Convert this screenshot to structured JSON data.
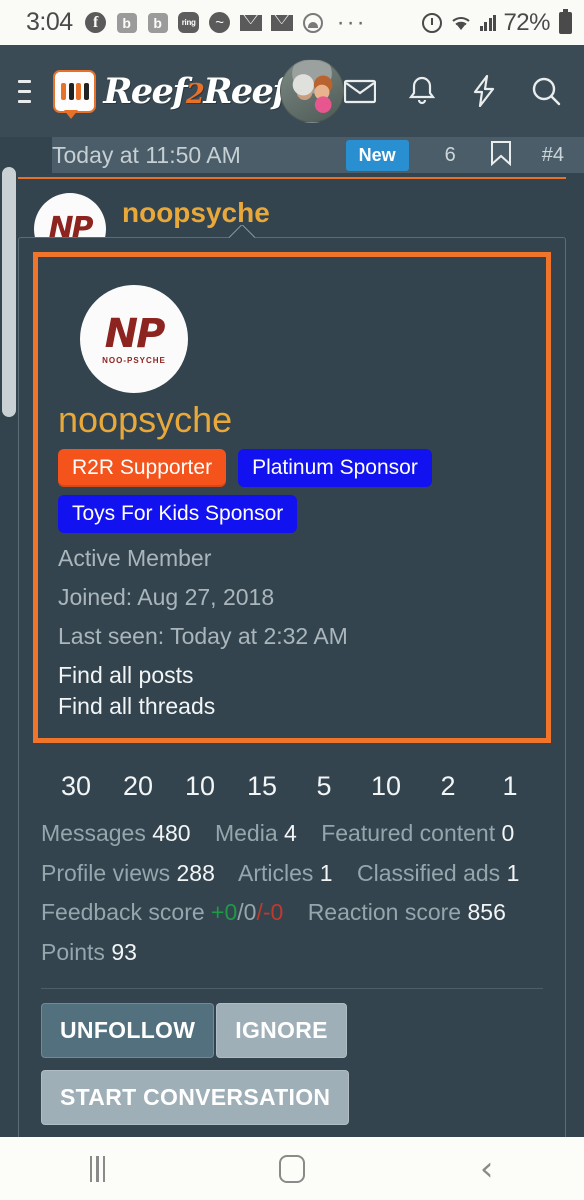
{
  "status_bar": {
    "time": "3:04",
    "icons": [
      "facebook-icon",
      "badge-b-icon",
      "badge-b-icon",
      "ring-icon",
      "messenger-icon",
      "email-icon",
      "email-icon",
      "face-icon"
    ],
    "overflow": "···",
    "alarm": "alarm-icon",
    "wifi": "wifi-icon",
    "signal": "signal-icon",
    "battery_pct": "72%"
  },
  "navbar": {
    "menu": "hamburger-icon",
    "brand": "Reef",
    "brand_two": "2",
    "brand_tail": "Reef",
    "avatar": "user-avatar",
    "icons": [
      "mail-icon",
      "bell-icon",
      "bolt-icon",
      "search-icon"
    ]
  },
  "post": {
    "date": "Today at 11:50 AM",
    "new_badge": "New",
    "likes": "6",
    "bookmark": "bookmark-icon",
    "post_number": "#4",
    "author": "noopsyche",
    "author_title": "Active Member"
  },
  "member_card": {
    "avatar_mark": "NP",
    "avatar_sub": "NOO-PSYCHE",
    "username": "noopsyche",
    "badges": [
      {
        "label": "R2R Supporter",
        "color": "#f4531c"
      },
      {
        "label": "Platinum Sponsor",
        "color": "#1212f0"
      },
      {
        "label": "Toys For Kids Sponsor",
        "color": "#1212f0"
      }
    ],
    "user_title": "Active Member",
    "joined": "Joined: Aug 27, 2018",
    "last_seen": "Last seen: Today at 2:32 AM",
    "find_posts": "Find all posts",
    "find_threads": "Find all threads",
    "trophies": [
      "30",
      "20",
      "10",
      "15",
      "5",
      "10",
      "2",
      "1"
    ],
    "stats": {
      "messages_label": "Messages",
      "messages_value": "480",
      "media_label": "Media",
      "media_value": "4",
      "featured_label": "Featured content",
      "featured_value": "0",
      "profile_views_label": "Profile views",
      "profile_views_value": "288",
      "articles_label": "Articles",
      "articles_value": "1",
      "classified_label": "Classified ads",
      "classified_value": "1",
      "feedback_label": "Feedback score",
      "feedback_pos": "+0",
      "feedback_sep1": "/0",
      "feedback_neg": "/-0",
      "reaction_label": "Reaction score",
      "reaction_value": "856",
      "points_label": "Points",
      "points_value": "93"
    },
    "buttons": {
      "unfollow": "UNFOLLOW",
      "ignore": "IGNORE",
      "start_conversation": "START CONVERSATION"
    }
  },
  "nav_bottom": {
    "recents": "recents-icon",
    "home": "home-icon",
    "back": "‹"
  }
}
